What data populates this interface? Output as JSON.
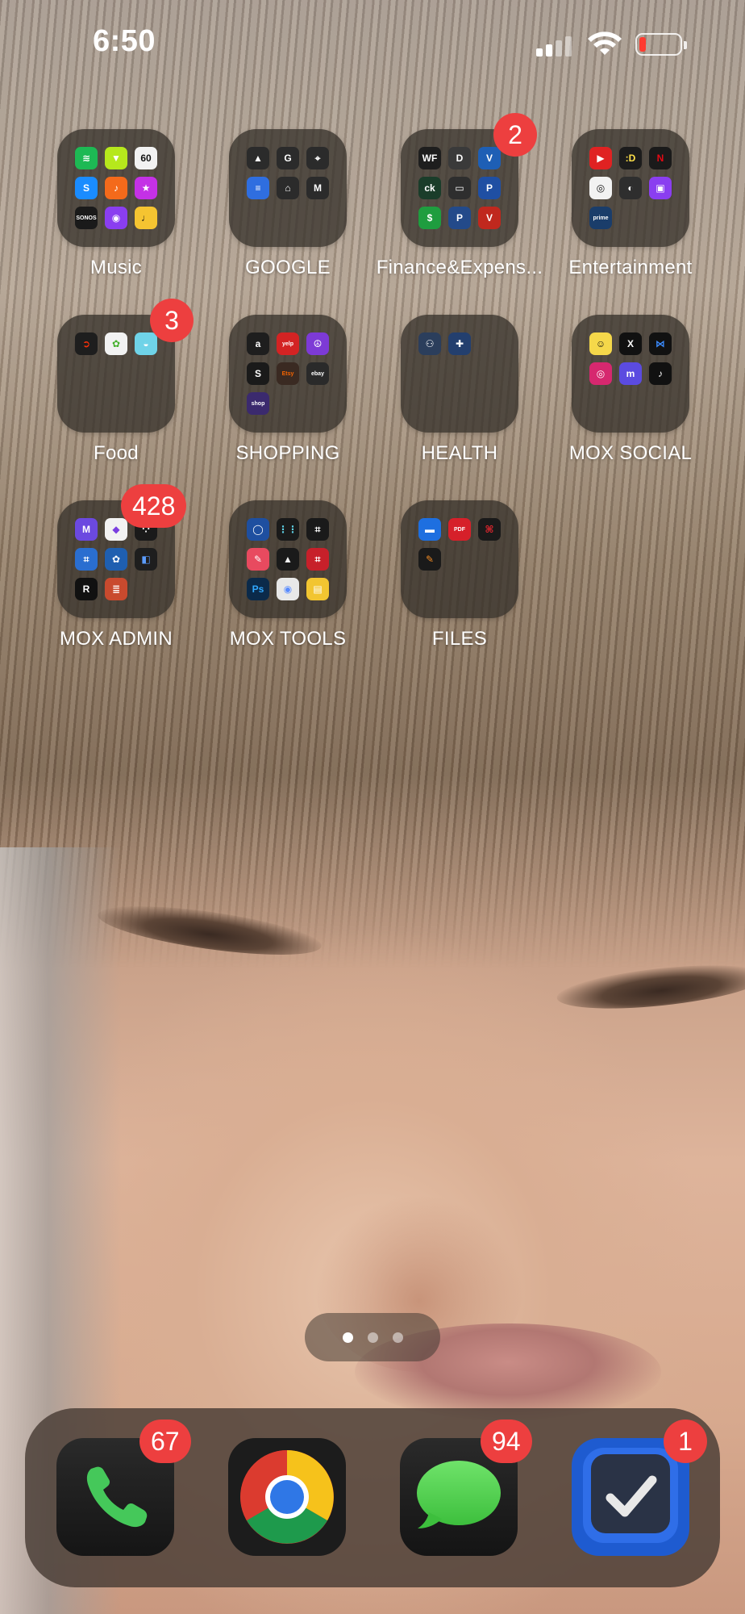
{
  "status_bar": {
    "time": "6:50",
    "cellular_icon": "cellular-signal-icon",
    "wifi_icon": "wifi-icon",
    "battery_icon": "battery-low-icon",
    "battery_level": 0.1,
    "battery_color": "#ff3b30"
  },
  "folders": [
    {
      "label": "Music",
      "badge": null,
      "apps": [
        {
          "icon": "spotify-icon",
          "bg": "#1db954",
          "glyph": "≋"
        },
        {
          "icon": "tuner-icon",
          "bg": "#b6e81c",
          "glyph": "▼"
        },
        {
          "icon": "metronome-60-icon",
          "bg": "#f2f2f2",
          "glyph": "60",
          "fg": "#111"
        },
        {
          "icon": "shazam-icon",
          "bg": "#1a8cff",
          "glyph": "S"
        },
        {
          "icon": "garageband-icon",
          "bg": "#f46a1b",
          "glyph": "♪"
        },
        {
          "icon": "itunes-store-icon",
          "bg": "#c431e6",
          "glyph": "★"
        },
        {
          "icon": "sonos-icon",
          "bg": "#1a1a1a",
          "glyph": "SONOS"
        },
        {
          "icon": "podcasts-icon",
          "bg": "#8a3ef0",
          "glyph": "◉"
        },
        {
          "icon": "tuner-app-icon",
          "bg": "#f5c431",
          "glyph": "♩",
          "fg": "#111"
        }
      ]
    },
    {
      "label": "GOOGLE",
      "badge": null,
      "apps": [
        {
          "icon": "google-drive-icon",
          "bg": "#2b2b2b",
          "glyph": "▲"
        },
        {
          "icon": "google-icon",
          "bg": "#2b2b2b",
          "glyph": "G"
        },
        {
          "icon": "google-maps-icon",
          "bg": "#2b2b2b",
          "glyph": "⌖"
        },
        {
          "icon": "google-docs-icon",
          "bg": "#2f6ee0",
          "glyph": "≡"
        },
        {
          "icon": "google-home-icon",
          "bg": "#2b2b2b",
          "glyph": "⌂"
        },
        {
          "icon": "gmail-icon",
          "bg": "#2b2b2b",
          "glyph": "M"
        }
      ]
    },
    {
      "label": "Finance&Expens...",
      "badge": "2",
      "apps": [
        {
          "icon": "wells-fargo-icon",
          "bg": "#1e1e1e",
          "glyph": "WF"
        },
        {
          "icon": "discover-icon",
          "bg": "#3a3a3a",
          "glyph": "D"
        },
        {
          "icon": "venmo-icon",
          "bg": "#1e5fb5",
          "glyph": "V"
        },
        {
          "icon": "credit-karma-icon",
          "bg": "#1a3d2a",
          "glyph": "ck"
        },
        {
          "icon": "wallet-icon",
          "bg": "#2e2e2e",
          "glyph": "▭"
        },
        {
          "icon": "paypal-icon",
          "bg": "#1f4fa3",
          "glyph": "P"
        },
        {
          "icon": "cash-app-icon",
          "bg": "#1f9d3f",
          "glyph": "$"
        },
        {
          "icon": "paypal-alt-icon",
          "bg": "#234a8a",
          "glyph": "P"
        },
        {
          "icon": "vanguard-icon",
          "bg": "#c0281e",
          "glyph": "V"
        }
      ]
    },
    {
      "label": "Entertainment",
      "badge": null,
      "apps": [
        {
          "icon": "youtube-icon",
          "bg": "#e02222",
          "glyph": "▶"
        },
        {
          "icon": "doordash-d-icon",
          "bg": "#1c1c1c",
          "glyph": ":D",
          "fg": "#ffe14a"
        },
        {
          "icon": "netflix-icon",
          "bg": "#1a1a1a",
          "glyph": "N",
          "fg": "#e50914"
        },
        {
          "icon": "crunchyroll-icon",
          "bg": "#f2f2f2",
          "glyph": "◎",
          "fg": "#111"
        },
        {
          "icon": "pastel-icon",
          "bg": "#2e2e2e",
          "glyph": "◐"
        },
        {
          "icon": "twitch-icon",
          "bg": "#8a3ef0",
          "glyph": "▣"
        },
        {
          "icon": "prime-video-icon",
          "bg": "#1a3d6a",
          "glyph": "prime"
        }
      ]
    },
    {
      "label": "Food",
      "badge": "3",
      "apps": [
        {
          "icon": "doordash-icon",
          "bg": "#1e1e1e",
          "glyph": "➲",
          "fg": "#ff3008"
        },
        {
          "icon": "instacart-icon",
          "bg": "#f2f2f2",
          "glyph": "✿",
          "fg": "#43b02a"
        },
        {
          "icon": "rice-cooker-icon",
          "bg": "#6fd3e8",
          "glyph": "◒"
        }
      ]
    },
    {
      "label": "SHOPPING",
      "badge": null,
      "apps": [
        {
          "icon": "amazon-icon",
          "bg": "#1e1e1e",
          "glyph": "a"
        },
        {
          "icon": "yelp-icon",
          "bg": "#d32323",
          "glyph": "yelp"
        },
        {
          "icon": "peace-icon",
          "bg": "#7d3ad6",
          "glyph": "☮"
        },
        {
          "icon": "square-s-icon",
          "bg": "#1a1a1a",
          "glyph": "S"
        },
        {
          "icon": "etsy-icon",
          "bg": "#3a2a22",
          "glyph": "Etsy",
          "fg": "#f56400"
        },
        {
          "icon": "ebay-icon",
          "bg": "#2a2a2a",
          "glyph": "ebay"
        },
        {
          "icon": "shop-icon",
          "bg": "#3b2a6e",
          "glyph": "shop"
        }
      ]
    },
    {
      "label": "HEALTH",
      "badge": null,
      "apps": [
        {
          "icon": "health-family-icon",
          "bg": "#2b3e5c",
          "glyph": "⚇"
        },
        {
          "icon": "health-clinic-icon",
          "bg": "#233f6e",
          "glyph": "✚"
        }
      ]
    },
    {
      "label": "MOX SOCIAL",
      "badge": null,
      "apps": [
        {
          "icon": "sun-emoji-icon",
          "bg": "#f5d84a",
          "glyph": "☺",
          "fg": "#111"
        },
        {
          "icon": "x-twitter-icon",
          "bg": "#111111",
          "glyph": "X"
        },
        {
          "icon": "bluesky-icon",
          "bg": "#111111",
          "glyph": "⋈",
          "fg": "#3b8cff"
        },
        {
          "icon": "instagram-icon",
          "bg": "#d6286f",
          "glyph": "◎"
        },
        {
          "icon": "mastodon-icon",
          "bg": "#5b4be0",
          "glyph": "m"
        },
        {
          "icon": "tiktok-icon",
          "bg": "#111111",
          "glyph": "♪"
        }
      ]
    },
    {
      "label": "MOX ADMIN",
      "badge": "428",
      "apps": [
        {
          "icon": "mail-m-icon",
          "bg": "#6b49e0",
          "glyph": "M"
        },
        {
          "icon": "diamond-app-icon",
          "bg": "#f2f2f2",
          "glyph": "◆",
          "fg": "#7a3ee0"
        },
        {
          "icon": "dots-app-icon",
          "bg": "#1a1a1a",
          "glyph": "⁘"
        },
        {
          "icon": "qr-scanner-icon",
          "bg": "#2a6ed0",
          "glyph": "⌗"
        },
        {
          "icon": "flower-app-icon",
          "bg": "#1f5fb0",
          "glyph": "✿"
        },
        {
          "icon": "kite-app-icon",
          "bg": "#1e1e1e",
          "glyph": "◧",
          "fg": "#5b9cff"
        },
        {
          "icon": "r-app-icon",
          "bg": "#111111",
          "glyph": "R"
        },
        {
          "icon": "stack-app-icon",
          "bg": "#c94a2e",
          "glyph": "≣"
        }
      ]
    },
    {
      "label": "MOX TOOLS",
      "badge": null,
      "apps": [
        {
          "icon": "camera-app-icon",
          "bg": "#1e4fa0",
          "glyph": "◯"
        },
        {
          "icon": "sliders-app-icon",
          "bg": "#1a1a1a",
          "glyph": "⋮⋮",
          "fg": "#5fd3e8"
        },
        {
          "icon": "crop-icon",
          "bg": "#1a1a1a",
          "glyph": "⌗"
        },
        {
          "icon": "edit-app-icon",
          "bg": "#e84a5f",
          "glyph": "✎"
        },
        {
          "icon": "vlc-icon",
          "bg": "#1a1a1a",
          "glyph": "▲",
          "fg": "#f0f0f0"
        },
        {
          "icon": "crop-red-icon",
          "bg": "#c7202a",
          "glyph": "⌗"
        },
        {
          "icon": "photoshop-icon",
          "bg": "#0b2a4a",
          "glyph": "Ps",
          "fg": "#31a8ff"
        },
        {
          "icon": "color-picker-icon",
          "bg": "#e8e8e8",
          "glyph": "◉",
          "fg": "#5a8cff"
        },
        {
          "icon": "rainbow-app-icon",
          "bg": "#f2c531",
          "glyph": "▤"
        }
      ]
    },
    {
      "label": "FILES",
      "badge": null,
      "apps": [
        {
          "icon": "files-icon",
          "bg": "#1e6fe0",
          "glyph": "▬"
        },
        {
          "icon": "pdf-editor-icon",
          "bg": "#d6202a",
          "glyph": "PDF"
        },
        {
          "icon": "acrobat-icon",
          "bg": "#1a1a1a",
          "glyph": "⌘",
          "fg": "#e0262e"
        },
        {
          "icon": "pencil-app-icon",
          "bg": "#1a1a1a",
          "glyph": "✎",
          "fg": "#f08a24"
        }
      ]
    }
  ],
  "page_indicator": {
    "pages": 3,
    "current": 1
  },
  "dock": [
    {
      "app": "Phone",
      "icon": "phone-icon",
      "badge": "67"
    },
    {
      "app": "Chrome",
      "icon": "chrome-icon",
      "badge": null
    },
    {
      "app": "Messages",
      "icon": "messages-icon",
      "badge": "94"
    },
    {
      "app": "Tasks",
      "icon": "checkmark-icon",
      "badge": "1"
    }
  ]
}
